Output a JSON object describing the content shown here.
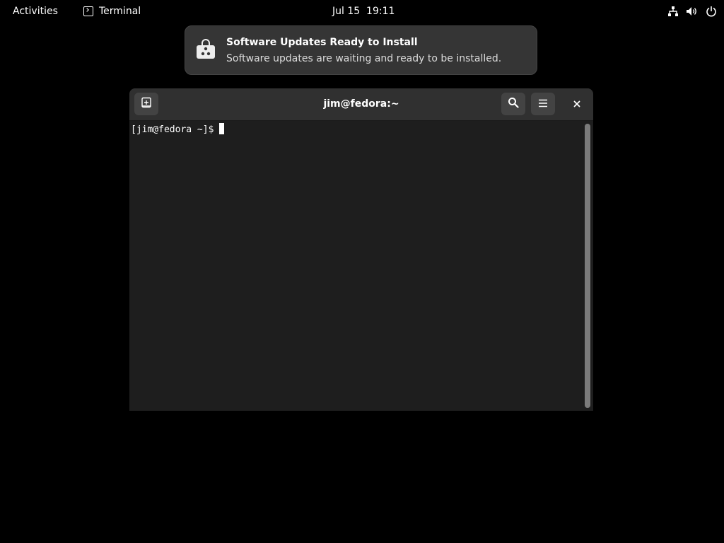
{
  "topbar": {
    "activities_label": "Activities",
    "app_name": "Terminal",
    "app_icon": "terminal-icon",
    "clock": "Jul 15  19:11",
    "status_icons": [
      "network-icon",
      "volume-icon",
      "power-icon"
    ]
  },
  "notification": {
    "icon": "software-store-icon",
    "title": "Software Updates Ready to Install",
    "body": "Software updates are waiting and ready to be installed."
  },
  "terminal": {
    "title": "jim@fedora:~",
    "prompt": "[jim@fedora ~]$",
    "buttons": [
      "new-tab-icon",
      "search-icon",
      "hamburger-menu-icon",
      "close-icon"
    ]
  },
  "colors": {
    "desktop_bg": "#000000",
    "headerbar_bg": "#303030",
    "terminal_bg": "#1e1e1e",
    "notification_bg": "#353535",
    "button_bg": "#434343"
  }
}
